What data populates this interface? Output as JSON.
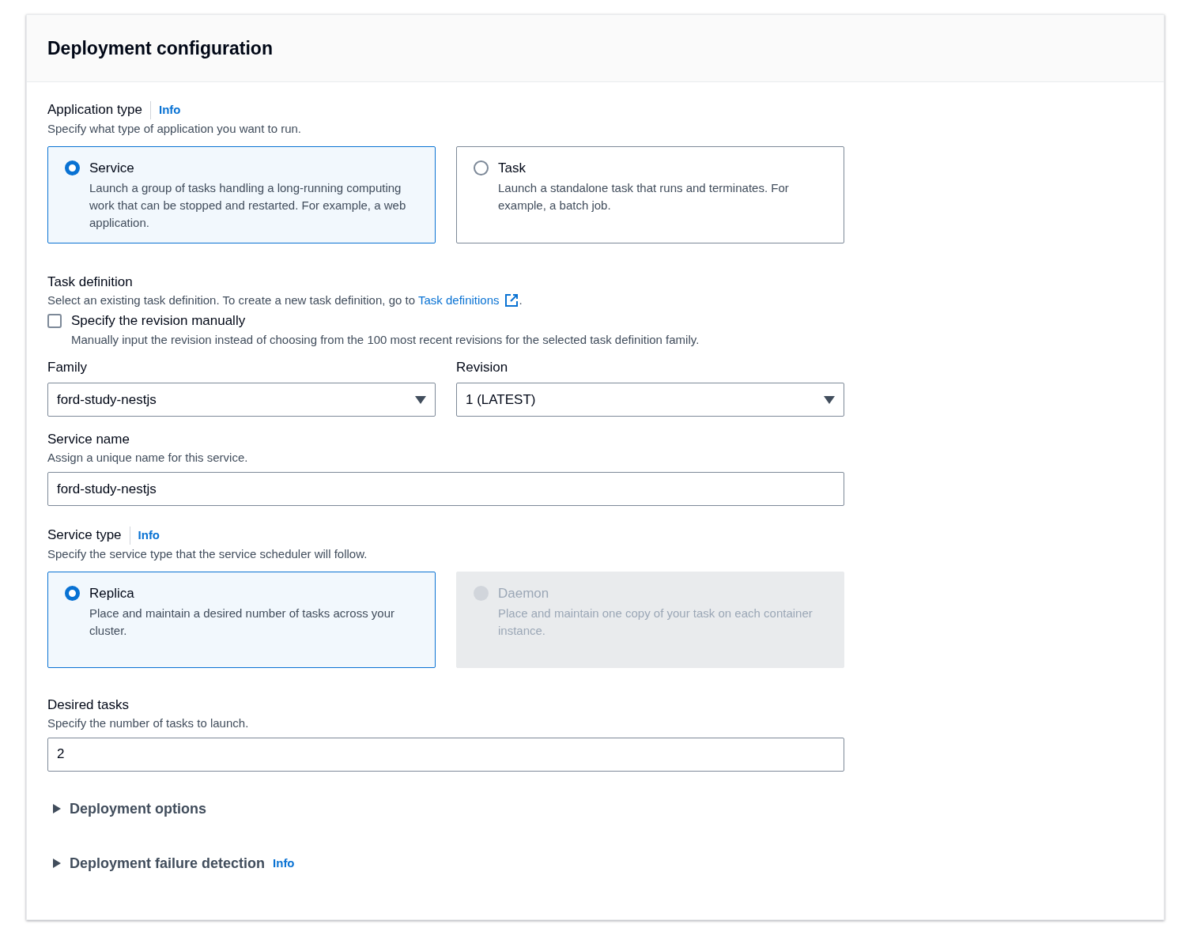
{
  "section": {
    "title": "Deployment configuration"
  },
  "application_type": {
    "label": "Application type",
    "info": "Info",
    "description": "Specify what type of application you want to run.",
    "options": [
      {
        "label": "Service",
        "description": "Launch a group of tasks handling a long-running computing work that can be stopped and restarted. For example, a web application.",
        "selected": true,
        "disabled": false
      },
      {
        "label": "Task",
        "description": "Launch a standalone task that runs and terminates. For example, a batch job.",
        "selected": false,
        "disabled": false
      }
    ]
  },
  "task_definition": {
    "label": "Task definition",
    "description_before": "Select an existing task definition. To create a new task definition, go to ",
    "link": "Task definitions",
    "description_after": ".",
    "manual_revision": {
      "label": "Specify the revision manually",
      "description": "Manually input the revision instead of choosing from the 100 most recent revisions for the selected task definition family.",
      "checked": false
    }
  },
  "family": {
    "label": "Family",
    "value": "ford-study-nestjs"
  },
  "revision": {
    "label": "Revision",
    "value": "1 (LATEST)"
  },
  "service_name": {
    "label": "Service name",
    "description": "Assign a unique name for this service.",
    "value": "ford-study-nestjs"
  },
  "service_type": {
    "label": "Service type",
    "info": "Info",
    "description": "Specify the service type that the service scheduler will follow.",
    "options": [
      {
        "label": "Replica",
        "description": "Place and maintain a desired number of tasks across your cluster.",
        "selected": true,
        "disabled": false
      },
      {
        "label": "Daemon",
        "description": "Place and maintain one copy of your task on each container instance.",
        "selected": false,
        "disabled": true
      }
    ]
  },
  "desired_tasks": {
    "label": "Desired tasks",
    "description": "Specify the number of tasks to launch.",
    "value": "2"
  },
  "expandables": [
    {
      "label": "Deployment options",
      "expanded": false
    },
    {
      "label": "Deployment failure detection",
      "info": "Info",
      "expanded": false
    }
  ]
}
